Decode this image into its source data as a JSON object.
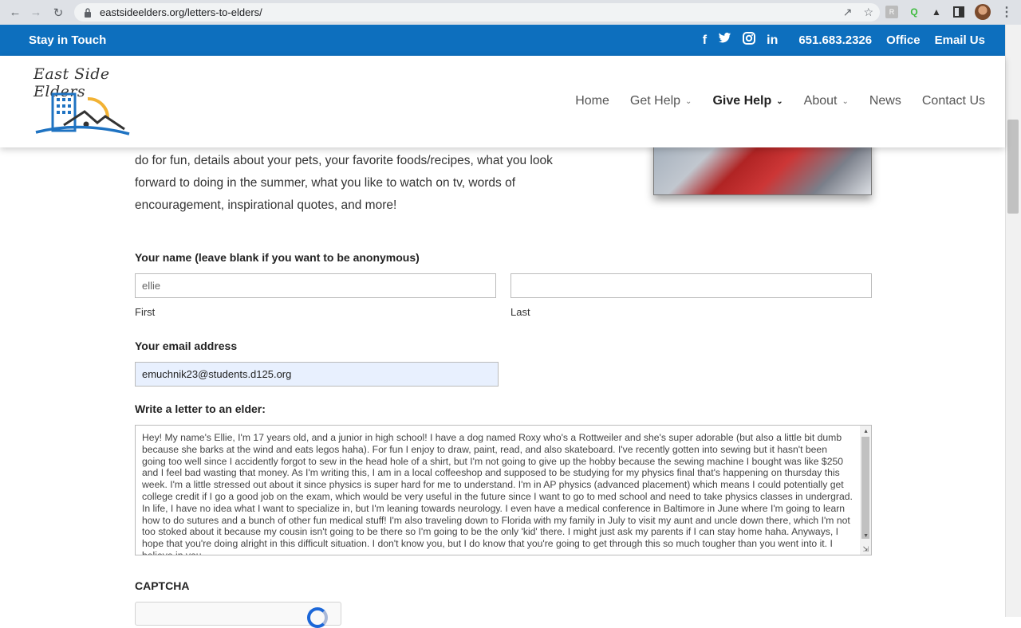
{
  "browser": {
    "url": "eastsideelders.org/letters-to-elders/"
  },
  "topbar": {
    "stay": "Stay in Touch",
    "social": [
      "f",
      "t",
      "ig",
      "in"
    ],
    "phone": "651.683.2326",
    "office": "Office",
    "email": "Email Us"
  },
  "header": {
    "logo_text": "East Side Elders",
    "menu": [
      {
        "label": "Home",
        "dropdown": false
      },
      {
        "label": "Get Help",
        "dropdown": true
      },
      {
        "label": "Give Help",
        "dropdown": true,
        "active": true
      },
      {
        "label": "About",
        "dropdown": true
      },
      {
        "label": "News",
        "dropdown": false
      },
      {
        "label": "Contact Us",
        "dropdown": false
      }
    ]
  },
  "intro": {
    "text": "do for fun, details about your pets, your favorite foods/recipes, what you look forward to doing in the summer, what you like to watch on tv, words of encouragement, inspirational quotes, and more!"
  },
  "form": {
    "name_label": "Your name (leave blank if you want to be anonymous)",
    "first_value": "ellie",
    "first_sub": "First",
    "last_value": "",
    "last_sub": "Last",
    "email_label": "Your email address",
    "email_value": "emuchnik23@students.d125.org",
    "letter_label": "Write a letter to an elder:",
    "letter_value": "Hey! My name's Ellie, I'm 17 years old, and a junior in high school! I have a dog named Roxy who's a Rottweiler and she's super adorable (but also a little bit dumb because she barks at the wind and eats legos haha). For fun I enjoy to draw, paint, read, and also skateboard. I've recently gotten into sewing but it hasn't been going too well since I accidently forgot to sew in the head hole of a shirt, but I'm not going to give up the hobby because the sewing machine I bought was like $250 and I feel bad wasting that money.  As I'm writing this, I am in a local coffeeshop and supposed to be studying for my physics final that's happening on thursday this week. I'm a little stressed out about it since physics is super hard for me to understand. I'm in AP physics (advanced placement) which means I could potentially get college credit if I go a good job on the exam, which would be very useful in the future since I want to go to med school and need to take physics classes in undergrad. In life, I have no idea what I want to specialize in, but I'm leaning towards neurology. I even have a medical conference in Baltimore in June where I'm going to learn how to do sutures and a bunch of other fun medical stuff! I'm also traveling down to Florida with my family in July to visit my aunt and uncle down there, which I'm not too stoked about it because my cousin isn't going to be there so I'm going to be the only 'kid' there. I might just ask my parents if I can stay home haha. Anyways, I hope that you're doing alright in this difficult situation. I don't know you,  but I do know that you're going to get through this so much tougher than you went into it. I believe in you.",
    "captcha_label": "CAPTCHA"
  },
  "colors": {
    "brand_blue": "#0d6fbe"
  }
}
